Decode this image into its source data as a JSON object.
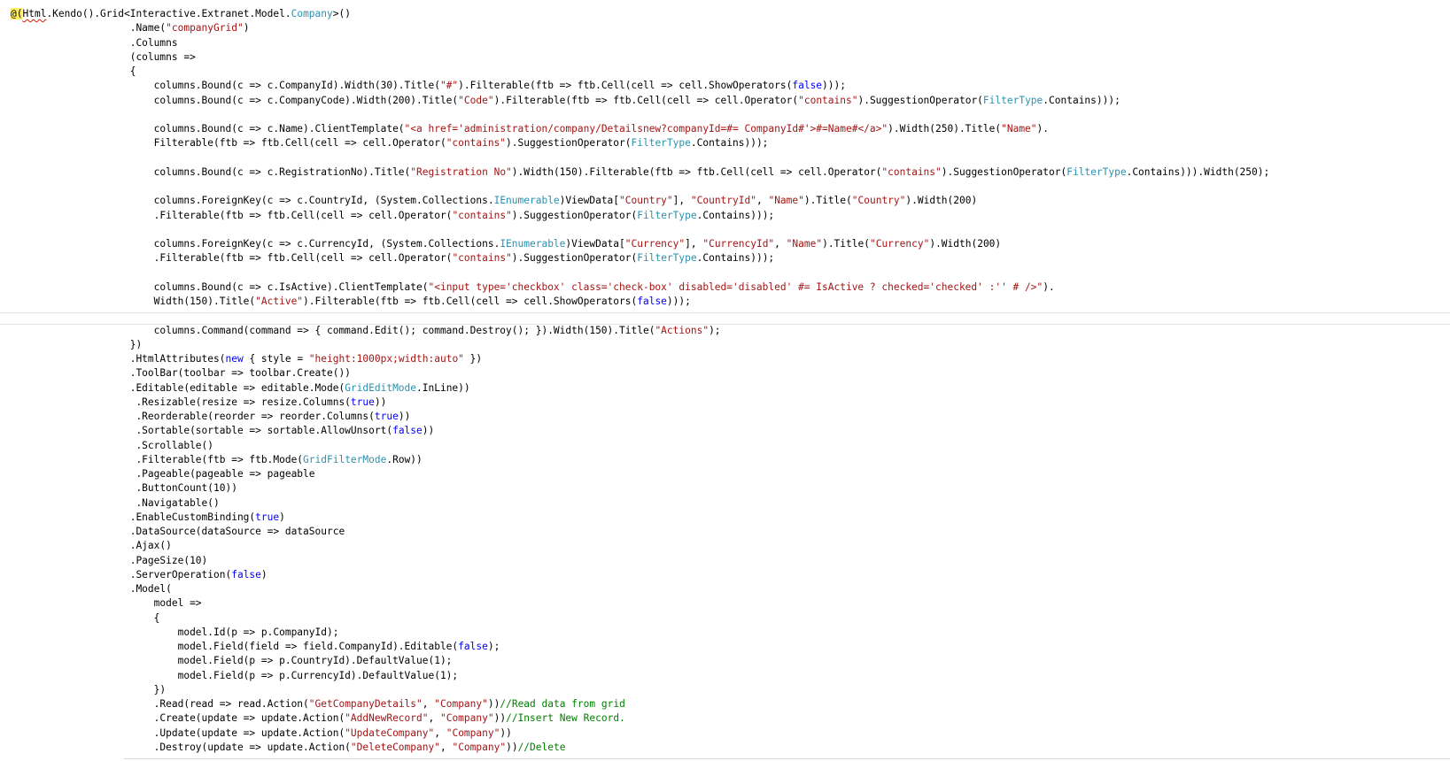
{
  "editor": {
    "colors": {
      "keyword": "#0000ff",
      "string": "#a31515",
      "type": "#2b91af",
      "comment": "#008000",
      "razor_highlight": "#ffee62"
    },
    "lines": [
      [
        [
          "razor",
          "@("
        ],
        [
          "sq",
          "Html"
        ],
        [
          "p",
          ".Kendo().Grid<Interactive.Extranet.Model."
        ],
        [
          "t",
          "Company"
        ],
        [
          "p",
          ">()"
        ]
      ],
      [
        [
          "p",
          "                    .Name("
        ],
        [
          "s",
          "\"companyGrid\""
        ],
        [
          "p",
          ")"
        ]
      ],
      [
        [
          "p",
          "                    .Columns"
        ]
      ],
      [
        [
          "p",
          "                    (columns =>"
        ]
      ],
      [
        [
          "p",
          "                    {"
        ]
      ],
      [
        [
          "p",
          "                        columns.Bound(c => c.CompanyId).Width(30).Title("
        ],
        [
          "s",
          "\"#\""
        ],
        [
          "p",
          ").Filterable(ftb => ftb.Cell(cell => cell.ShowOperators("
        ],
        [
          "k",
          "false"
        ],
        [
          "p",
          ")));"
        ]
      ],
      [
        [
          "p",
          "                        columns.Bound(c => c.CompanyCode).Width(200).Title("
        ],
        [
          "s",
          "\"Code\""
        ],
        [
          "p",
          ").Filterable(ftb => ftb.Cell(cell => cell.Operator("
        ],
        [
          "s",
          "\"contains\""
        ],
        [
          "p",
          ").SuggestionOperator("
        ],
        [
          "t",
          "FilterType"
        ],
        [
          "p",
          ".Contains)));"
        ]
      ],
      [],
      [
        [
          "p",
          "                        columns.Bound(c => c.Name).ClientTemplate("
        ],
        [
          "s",
          "\"<a href='administration/company/Detailsnew?companyId=#= CompanyId#'>#=Name#</a>\""
        ],
        [
          "p",
          ").Width(250).Title("
        ],
        [
          "s",
          "\"Name\""
        ],
        [
          "p",
          ")."
        ]
      ],
      [
        [
          "p",
          "                        Filterable(ftb => ftb.Cell(cell => cell.Operator("
        ],
        [
          "s",
          "\"contains\""
        ],
        [
          "p",
          ").SuggestionOperator("
        ],
        [
          "t",
          "FilterType"
        ],
        [
          "p",
          ".Contains)));"
        ]
      ],
      [],
      [
        [
          "p",
          "                        columns.Bound(c => c.RegistrationNo).Title("
        ],
        [
          "s",
          "\"Registration No\""
        ],
        [
          "p",
          ").Width(150).Filterable(ftb => ftb.Cell(cell => cell.Operator("
        ],
        [
          "s",
          "\"contains\""
        ],
        [
          "p",
          ").SuggestionOperator("
        ],
        [
          "t",
          "FilterType"
        ],
        [
          "p",
          ".Contains))).Width(250);"
        ]
      ],
      [],
      [
        [
          "p",
          "                        columns.ForeignKey(c => c.CountryId, (System.Collections."
        ],
        [
          "t",
          "IEnumerable"
        ],
        [
          "p",
          ")ViewData["
        ],
        [
          "s",
          "\"Country\""
        ],
        [
          "p",
          "], "
        ],
        [
          "s",
          "\"CountryId\""
        ],
        [
          "p",
          ", "
        ],
        [
          "s",
          "\"Name\""
        ],
        [
          "p",
          ").Title("
        ],
        [
          "s",
          "\"Country\""
        ],
        [
          "p",
          ").Width(200)"
        ]
      ],
      [
        [
          "p",
          "                        .Filterable(ftb => ftb.Cell(cell => cell.Operator("
        ],
        [
          "s",
          "\"contains\""
        ],
        [
          "p",
          ").SuggestionOperator("
        ],
        [
          "t",
          "FilterType"
        ],
        [
          "p",
          ".Contains)));"
        ]
      ],
      [],
      [
        [
          "p",
          "                        columns.ForeignKey(c => c.CurrencyId, (System.Collections."
        ],
        [
          "t",
          "IEnumerable"
        ],
        [
          "p",
          ")ViewData["
        ],
        [
          "s",
          "\"Currency\""
        ],
        [
          "p",
          "], "
        ],
        [
          "s",
          "\"CurrencyId\""
        ],
        [
          "p",
          ", "
        ],
        [
          "s",
          "\"Name\""
        ],
        [
          "p",
          ").Title("
        ],
        [
          "s",
          "\"Currency\""
        ],
        [
          "p",
          ").Width(200)"
        ]
      ],
      [
        [
          "p",
          "                        .Filterable(ftb => ftb.Cell(cell => cell.Operator("
        ],
        [
          "s",
          "\"contains\""
        ],
        [
          "p",
          ").SuggestionOperator("
        ],
        [
          "t",
          "FilterType"
        ],
        [
          "p",
          ".Contains)));"
        ]
      ],
      [],
      [
        [
          "p",
          "                        columns.Bound(c => c.IsActive).ClientTemplate("
        ],
        [
          "s",
          "\"<input type='checkbox' class='check-box' disabled='disabled' #= IsActive ? checked='checked' :'' # />\""
        ],
        [
          "p",
          ")."
        ]
      ],
      [
        [
          "p",
          "                        Width(150).Title("
        ],
        [
          "s",
          "\"Active\""
        ],
        [
          "p",
          ").Filterable(ftb => ftb.Cell(cell => cell.ShowOperators("
        ],
        [
          "k",
          "false"
        ],
        [
          "p",
          ")));"
        ]
      ],
      [],
      [
        [
          "p",
          "                        columns.Command(command => { command.Edit(); command.Destroy(); }).Width(150).Title("
        ],
        [
          "s",
          "\"Actions\""
        ],
        [
          "p",
          ");"
        ]
      ],
      [
        [
          "p",
          "                    })"
        ]
      ],
      [
        [
          "p",
          "                    .HtmlAttributes("
        ],
        [
          "k",
          "new"
        ],
        [
          "p",
          " { style = "
        ],
        [
          "s",
          "\"height:1000px;width:auto\""
        ],
        [
          "p",
          " })"
        ]
      ],
      [
        [
          "p",
          "                    .ToolBar(toolbar => toolbar.Create())"
        ]
      ],
      [
        [
          "p",
          "                    .Editable(editable => editable.Mode("
        ],
        [
          "t",
          "GridEditMode"
        ],
        [
          "p",
          ".InLine))"
        ]
      ],
      [
        [
          "p",
          "                     .Resizable(resize => resize.Columns("
        ],
        [
          "k",
          "true"
        ],
        [
          "p",
          "))"
        ]
      ],
      [
        [
          "p",
          "                     .Reorderable(reorder => reorder.Columns("
        ],
        [
          "k",
          "true"
        ],
        [
          "p",
          "))"
        ]
      ],
      [
        [
          "p",
          "                     .Sortable(sortable => sortable.AllowUnsort("
        ],
        [
          "k",
          "false"
        ],
        [
          "p",
          "))"
        ]
      ],
      [
        [
          "p",
          "                     .Scrollable()"
        ]
      ],
      [
        [
          "p",
          "                     .Filterable(ftb => ftb.Mode("
        ],
        [
          "t",
          "GridFilterMode"
        ],
        [
          "p",
          ".Row))"
        ]
      ],
      [
        [
          "p",
          "                     .Pageable(pageable => pageable"
        ]
      ],
      [
        [
          "p",
          "                     .ButtonCount(10))"
        ]
      ],
      [
        [
          "p",
          "                     .Navigatable()"
        ]
      ],
      [
        [
          "p",
          "                    .EnableCustomBinding("
        ],
        [
          "k",
          "true"
        ],
        [
          "p",
          ")"
        ]
      ],
      [
        [
          "p",
          "                    .DataSource(dataSource => dataSource"
        ]
      ],
      [
        [
          "p",
          "                    .Ajax()"
        ]
      ],
      [
        [
          "p",
          "                    .PageSize(10)"
        ]
      ],
      [
        [
          "p",
          "                    .ServerOperation("
        ],
        [
          "k",
          "false"
        ],
        [
          "p",
          ")"
        ]
      ],
      [
        [
          "p",
          "                    .Model("
        ]
      ],
      [
        [
          "p",
          "                        model =>"
        ]
      ],
      [
        [
          "p",
          "                        {"
        ]
      ],
      [
        [
          "p",
          "                            model.Id(p => p.CompanyId);"
        ]
      ],
      [
        [
          "p",
          "                            model.Field(field => field.CompanyId).Editable("
        ],
        [
          "k",
          "false"
        ],
        [
          "p",
          ");"
        ]
      ],
      [
        [
          "p",
          "                            model.Field(p => p.CountryId).DefaultValue(1);"
        ]
      ],
      [
        [
          "p",
          "                            model.Field(p => p.CurrencyId).DefaultValue(1);"
        ]
      ],
      [
        [
          "p",
          "                        })"
        ]
      ],
      [
        [
          "p",
          "                        .Read(read => read.Action("
        ],
        [
          "s",
          "\"GetCompanyDetails\""
        ],
        [
          "p",
          ", "
        ],
        [
          "s",
          "\"Company\""
        ],
        [
          "p",
          "))"
        ],
        [
          "c",
          "//Read data from grid"
        ]
      ],
      [
        [
          "p",
          "                        .Create(update => update.Action("
        ],
        [
          "s",
          "\"AddNewRecord\""
        ],
        [
          "p",
          ", "
        ],
        [
          "s",
          "\"Company\""
        ],
        [
          "p",
          "))"
        ],
        [
          "c",
          "//Insert New Record."
        ]
      ],
      [
        [
          "p",
          "                        .Update(update => update.Action("
        ],
        [
          "s",
          "\"UpdateCompany\""
        ],
        [
          "p",
          ", "
        ],
        [
          "s",
          "\"Company\""
        ],
        [
          "p",
          "))"
        ]
      ],
      [
        [
          "p",
          "                        .Destroy(update => update.Action("
        ],
        [
          "s",
          "\"DeleteCompany\""
        ],
        [
          "p",
          ", "
        ],
        [
          "s",
          "\"Company\""
        ],
        [
          "p",
          "))"
        ],
        [
          "c",
          "//Delete"
        ]
      ]
    ]
  }
}
